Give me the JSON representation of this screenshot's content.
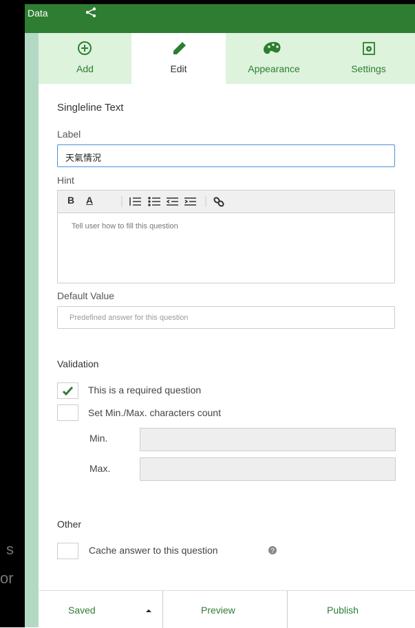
{
  "topbar": {
    "title": "Data",
    "share_icon": "share-icon"
  },
  "tabs": [
    {
      "label": "Add",
      "icon": "plus-circle-icon"
    },
    {
      "label": "Edit",
      "icon": "pencil-icon",
      "active": true
    },
    {
      "label": "Appearance",
      "icon": "palette-icon"
    },
    {
      "label": "Settings",
      "icon": "settings-gear-icon"
    }
  ],
  "form": {
    "title": "Singleline Text",
    "label_caption": "Label",
    "label_value": "天氣情況",
    "hint_caption": "Hint",
    "hint_placeholder": "Tell user how to fill this question",
    "hint_toolbar": [
      "B",
      "A"
    ],
    "default_caption": "Default Value",
    "default_placeholder": "Predefined answer for this question",
    "validation_title": "Validation",
    "required_label": "This is a required question",
    "required_checked": true,
    "minmax_label": "Set Min./Max. characters count",
    "minmax_checked": false,
    "min_label": "Min.",
    "max_label": "Max.",
    "other_title": "Other",
    "cache_label": "Cache answer to this question",
    "cache_checked": false
  },
  "footer": {
    "saved": "Saved",
    "preview": "Preview",
    "publish": "Publish"
  },
  "background_text": [
    "s",
    "or"
  ],
  "colors": {
    "primary": "#2e7d32",
    "tab_bg": "#ddf3dc",
    "rail": "#b3d9c5"
  }
}
